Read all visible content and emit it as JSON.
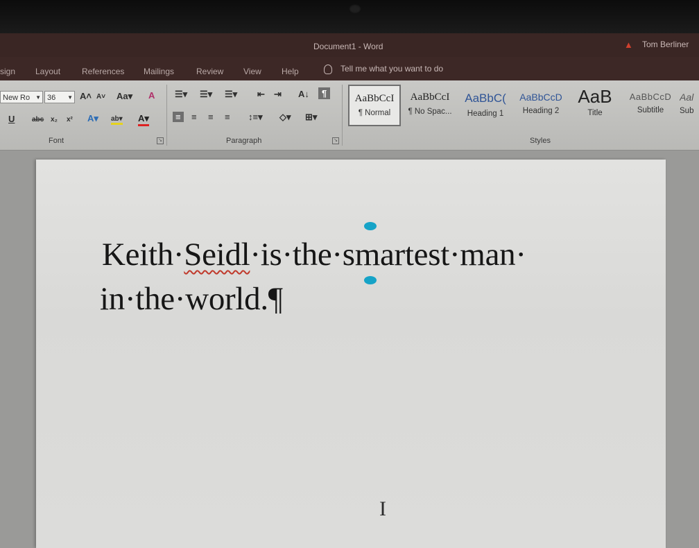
{
  "titlebar": {
    "document_title": "Document1  -  Word",
    "user": "Tom Berliner"
  },
  "tabs": [
    "sign",
    "Layout",
    "References",
    "Mailings",
    "Review",
    "View",
    "Help"
  ],
  "tell_me": "Tell me what you want to do",
  "font": {
    "name": "New Ro",
    "size": "36",
    "group_label": "Font"
  },
  "paragraph": {
    "group_label": "Paragraph"
  },
  "styles": {
    "group_label": "Styles",
    "items": [
      {
        "sample": "AaBbCcI",
        "name": "¶ Normal"
      },
      {
        "sample": "AaBbCcI",
        "name": "¶ No Spac..."
      },
      {
        "sample": "AaBbC(",
        "name": "Heading 1"
      },
      {
        "sample": "AaBbCcD",
        "name": "Heading 2"
      },
      {
        "sample": "AaB",
        "name": "Title"
      },
      {
        "sample": "AaBbCcD",
        "name": "Subtitle"
      },
      {
        "sample": "Aal",
        "name": "Sub"
      }
    ]
  },
  "document": {
    "line1_pre": "Keith·",
    "line1_word": "Seidl",
    "line1_post": "·is·the·smartest·man·",
    "line2": "in·the·world.¶"
  },
  "caret_glyph": "I",
  "colors": {
    "accent_selection": "#16a3c7",
    "titlebar": "#3a2624",
    "spelling_error": "#c0392b"
  }
}
